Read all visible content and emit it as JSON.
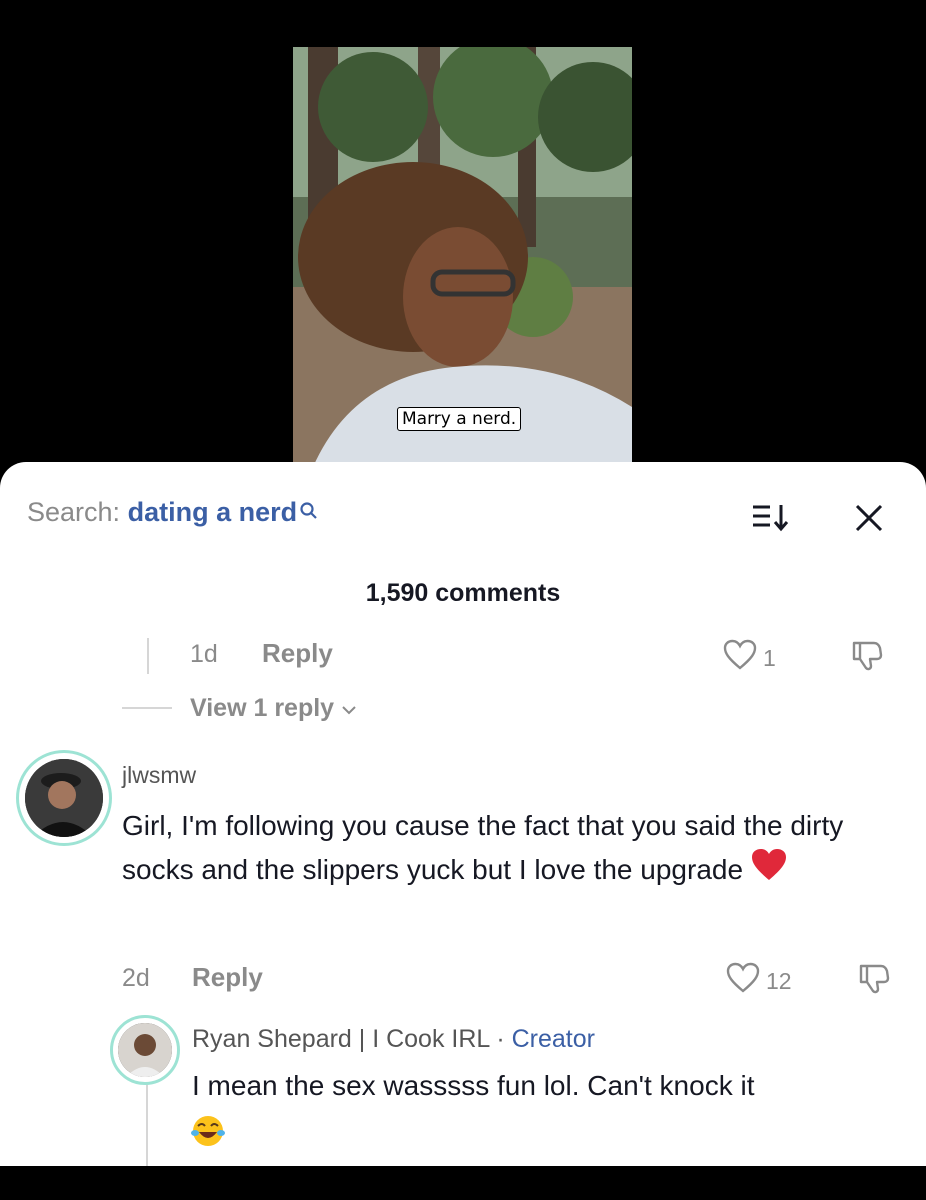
{
  "video": {
    "caption": "Marry a nerd."
  },
  "header": {
    "search_label": "Search:",
    "search_query": "dating a nerd",
    "comment_count": "1,590 comments"
  },
  "comments": [
    {
      "time": "1d",
      "reply_label": "Reply",
      "likes": "1",
      "view_replies": "View 1 reply"
    },
    {
      "username": "jlwsmw",
      "text": "Girl, I'm following you cause the fact that you said the dirty socks and the slippers yuck but I love the upgrade",
      "emoji": "red-heart-emoji",
      "time": "2d",
      "reply_label": "Reply",
      "likes": "12",
      "replies": [
        {
          "username": "Ryan Shepard | I Cook IRL",
          "separator": " · ",
          "badge": "Creator",
          "text": "I mean the sex wasssss fun lol. Can't knock it",
          "emoji": "tears-of-joy-emoji"
        }
      ]
    }
  ]
}
